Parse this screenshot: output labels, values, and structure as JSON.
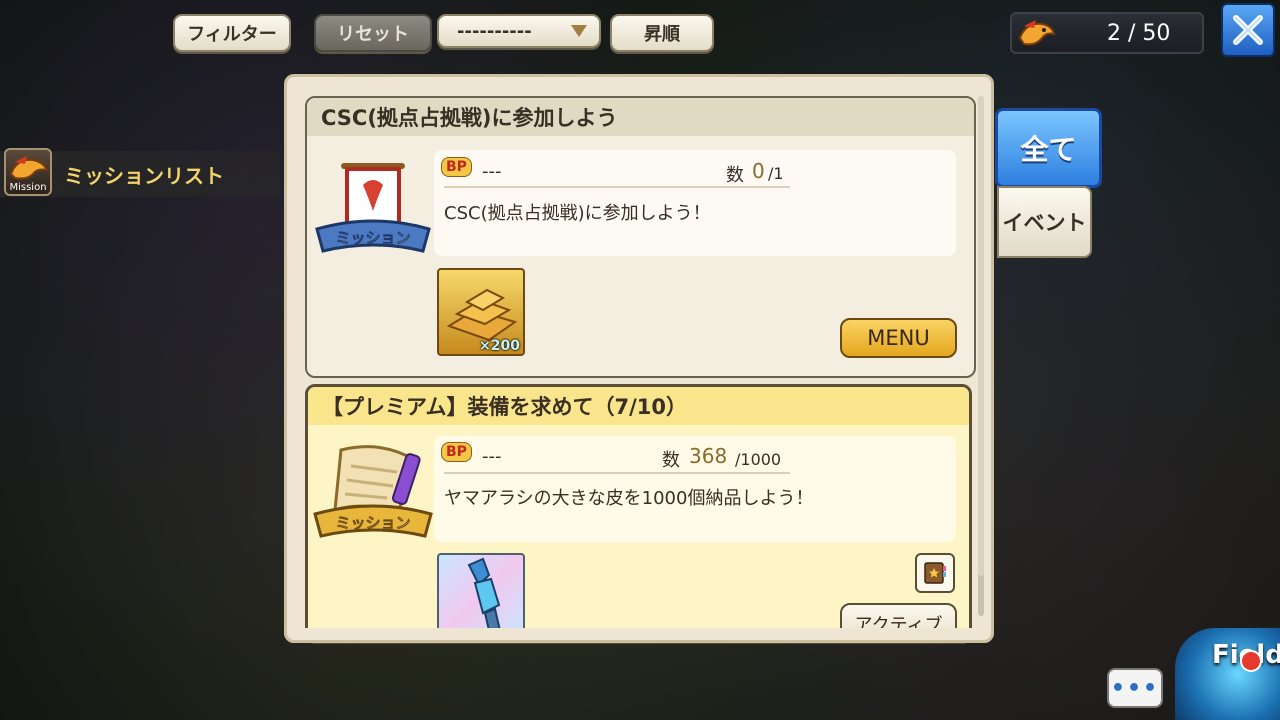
{
  "toolbar": {
    "filter_label": "フィルター",
    "reset_label": "リセット",
    "sort_select_value": "----------",
    "order_label": "昇順",
    "counter_value": "2 / 50"
  },
  "side": {
    "mission_icon_label": "Mission",
    "mission_list_title": "ミッションリスト"
  },
  "tabs": {
    "all_label": "全て",
    "event_label": "イベント"
  },
  "missions": [
    {
      "title": "CSC(拠点占拠戦)に参加しよう",
      "badge_label": "ミッション",
      "bp_label": "BP",
      "bp_value": "---",
      "count_label": "数",
      "count_current": "0",
      "count_target": "/1",
      "description": "CSC(拠点占拠戦)に参加しよう！",
      "reward_qty": "×200",
      "action_label": "MENU"
    },
    {
      "title": "【プレミアム】装備を求めて（7/10）",
      "badge_label": "ミッション",
      "bp_label": "BP",
      "bp_value": "---",
      "count_label": "数",
      "count_current": "368",
      "count_target": "/1000",
      "description": "ヤマアラシの大きな皮を1000個納品しよう！",
      "action_label": "アクティブ"
    }
  ],
  "bottom": {
    "chat_label": "•••",
    "field_label": "Field"
  },
  "colors": {
    "accent_blue": "#2d7fe0",
    "gold": "#e3a61d",
    "premium_bg": "#fdf5c6"
  }
}
